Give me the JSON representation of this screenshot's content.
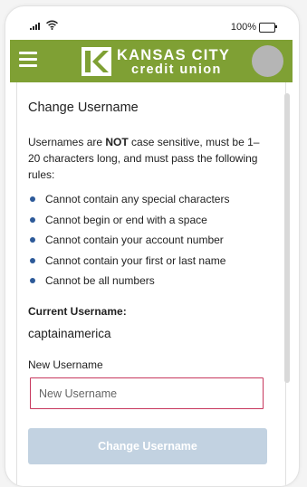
{
  "status_bar": {
    "battery_label": "100%",
    "icons": [
      "signal-icon",
      "wifi-icon",
      "battery-icon"
    ]
  },
  "header": {
    "brand_line1": "KANSAS CITY",
    "brand_line2": "credit union",
    "logo_letter": "K",
    "colors": {
      "background": "#7fa034",
      "text": "#ffffff",
      "avatar": "#b5b5b5"
    },
    "icons": [
      "hamburger-menu-icon",
      "kc-logo-icon",
      "avatar"
    ]
  },
  "page": {
    "title": "Change Username",
    "intro_before": "Usernames are ",
    "intro_bold": "NOT",
    "intro_after": " case sensitive, must be 1–20 characters long, and must pass the following rules:",
    "rules": [
      "Cannot contain any special characters",
      "Cannot begin or end with a space",
      "Cannot contain your account number",
      "Cannot contain your first or last name",
      "Cannot be all numbers"
    ],
    "current_label": "Current Username:",
    "current_value": "captainamerica",
    "new_label": "New Username",
    "new_value": "",
    "new_placeholder": "New Username",
    "submit_label": "Change Username",
    "colors": {
      "bullet": "#2d5a99",
      "input_border": "#c7375d",
      "button": "#c2d2e1"
    }
  }
}
